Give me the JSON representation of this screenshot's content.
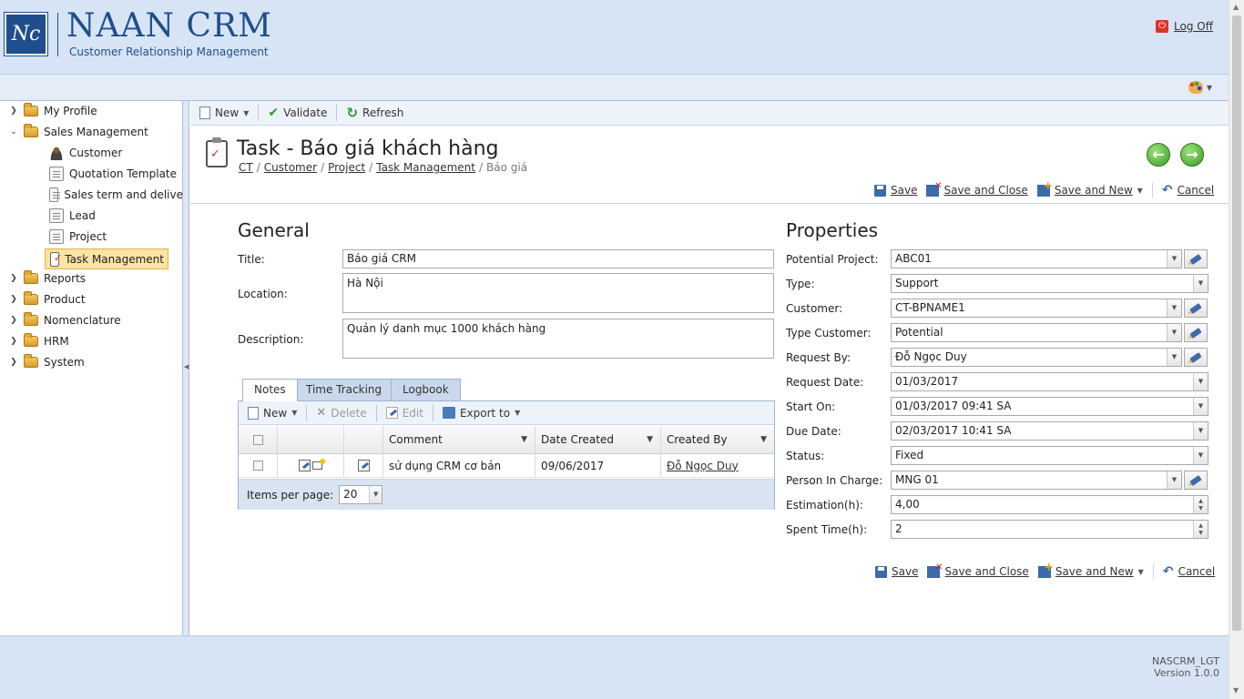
{
  "header": {
    "logo_mark": "Nc",
    "brand_name": "NAAN CRM",
    "brand_tagline": "Customer Relationship Management",
    "logoff_label": "Log Off"
  },
  "sidebar": {
    "items": [
      {
        "label": "My Profile"
      },
      {
        "label": "Sales Management"
      },
      {
        "label": "Customer"
      },
      {
        "label": "Quotation Template"
      },
      {
        "label": "Sales term and delive"
      },
      {
        "label": "Lead"
      },
      {
        "label": "Project"
      },
      {
        "label": "Task Management"
      },
      {
        "label": "Reports"
      },
      {
        "label": "Product"
      },
      {
        "label": "Nomenclature"
      },
      {
        "label": "HRM"
      },
      {
        "label": "System"
      }
    ]
  },
  "toolbar": {
    "new_label": "New",
    "validate_label": "Validate",
    "refresh_label": "Refresh"
  },
  "page": {
    "title": "Task - Báo giá khách hàng",
    "breadcrumb": {
      "ct": "CT",
      "customer": "Customer",
      "project": "Project",
      "task_management": "Task Management",
      "current": "Báo giá"
    }
  },
  "actions": {
    "save": "Save",
    "save_and_close": "Save and Close",
    "save_and_new": "Save and New",
    "cancel": "Cancel"
  },
  "general": {
    "heading": "General",
    "title_label": "Title:",
    "title_value": "Báo giá CRM",
    "location_label": "Location:",
    "location_value": "Hà Nội",
    "description_label": "Description:",
    "description_value": "Quản lý danh mục 1000 khách hàng"
  },
  "properties": {
    "heading": "Properties",
    "potential_project_label": "Potential Project:",
    "potential_project_value": "ABC01",
    "type_label": "Type:",
    "type_value": "Support",
    "customer_label": "Customer:",
    "customer_value": "CT-BPNAME1",
    "type_customer_label": "Type Customer:",
    "type_customer_value": "Potential",
    "request_by_label": "Request By:",
    "request_by_value": "Đỗ Ngọc Duy",
    "request_date_label": "Request Date:",
    "request_date_value": "01/03/2017",
    "start_on_label": "Start On:",
    "start_on_value": "01/03/2017 09:41 SA",
    "due_date_label": "Due Date:",
    "due_date_value": "02/03/2017 10:41 SA",
    "status_label": "Status:",
    "status_value": "Fixed",
    "person_in_charge_label": "Person In Charge:",
    "person_in_charge_value": "MNG 01",
    "estimation_label": "Estimation(h):",
    "estimation_value": "4,00",
    "spent_time_label": "Spent Time(h):",
    "spent_time_value": "2"
  },
  "tabs": {
    "notes": "Notes",
    "time_tracking": "Time Tracking",
    "logbook": "Logbook"
  },
  "grid": {
    "new_label": "New",
    "delete_label": "Delete",
    "edit_label": "Edit",
    "export_label": "Export to",
    "columns": {
      "comment": "Comment",
      "date_created": "Date Created",
      "created_by": "Created By"
    },
    "rows": [
      {
        "comment": "sử dụng CRM cơ bản",
        "date_created": "09/06/2017",
        "created_by": "Đỗ Ngọc Duy"
      }
    ],
    "items_per_page_label": "Items per page:",
    "items_per_page_value": "20"
  },
  "footer": {
    "app_code": "NASCRM_LGT",
    "version": "Version 1.0.0"
  }
}
